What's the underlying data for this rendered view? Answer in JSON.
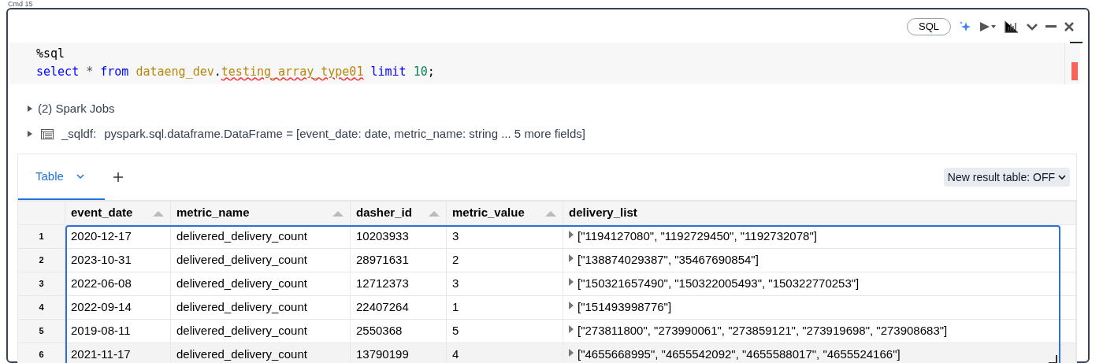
{
  "cell_label": "Cmd 15",
  "toolbar": {
    "language": "SQL"
  },
  "code_lines": [
    [
      {
        "text": "%sql",
        "kind": "plain"
      }
    ],
    [
      {
        "text": "select ",
        "kind": "keyword"
      },
      {
        "text": "* ",
        "kind": "operator"
      },
      {
        "text": "from ",
        "kind": "keyword"
      },
      {
        "text": "dataeng_dev",
        "kind": "identifier",
        "error": false
      },
      {
        "text": ".",
        "kind": "plain"
      },
      {
        "text": "testing_array_type01",
        "kind": "identifier",
        "error": true
      },
      {
        "text": " limit ",
        "kind": "keyword"
      },
      {
        "text": "10",
        "kind": "number"
      },
      {
        "text": ";",
        "kind": "plain"
      }
    ]
  ],
  "outputs": [
    {
      "kind": "jobs",
      "label": "(2) Spark Jobs",
      "expanded": false
    },
    {
      "kind": "dataframe",
      "name": "_sqldf:",
      "schema": "pyspark.sql.dataframe.DataFrame = [event_date: date, metric_name: string ... 5 more fields]",
      "expanded": false
    }
  ],
  "result_tabs": [
    {
      "label": "Table",
      "selected": true
    }
  ],
  "new_result_table": "New result table: OFF",
  "table": {
    "columns": [
      "",
      "event_date",
      "metric_name",
      "dasher_id",
      "metric_value",
      "delivery_list"
    ],
    "rows": [
      [
        "1",
        "2020-12-17",
        "delivered_delivery_count",
        "10203933",
        "3",
        "[\"1194127080\", \"1192729450\", \"1192732078\"]"
      ],
      [
        "2",
        "2023-10-31",
        "delivered_delivery_count",
        "28971631",
        "2",
        "[\"138874029387\", \"35467690854\"]"
      ],
      [
        "3",
        "2022-06-08",
        "delivered_delivery_count",
        "12712373",
        "3",
        "[\"150321657490\", \"150322005493\", \"150322770253\"]"
      ],
      [
        "4",
        "2022-09-14",
        "delivered_delivery_count",
        "22407264",
        "1",
        "[\"151493998776\"]"
      ],
      [
        "5",
        "2019-08-11",
        "delivered_delivery_count",
        "2550368",
        "5",
        "[\"273811800\", \"273990061\", \"273859121\", \"273919698\", \"273908683\"]"
      ],
      [
        "6",
        "2021-11-17",
        "delivered_delivery_count",
        "13790199",
        "4",
        "[\"4655668995\", \"4655542092\", \"4655588017\", \"4655524166\"]"
      ]
    ]
  }
}
